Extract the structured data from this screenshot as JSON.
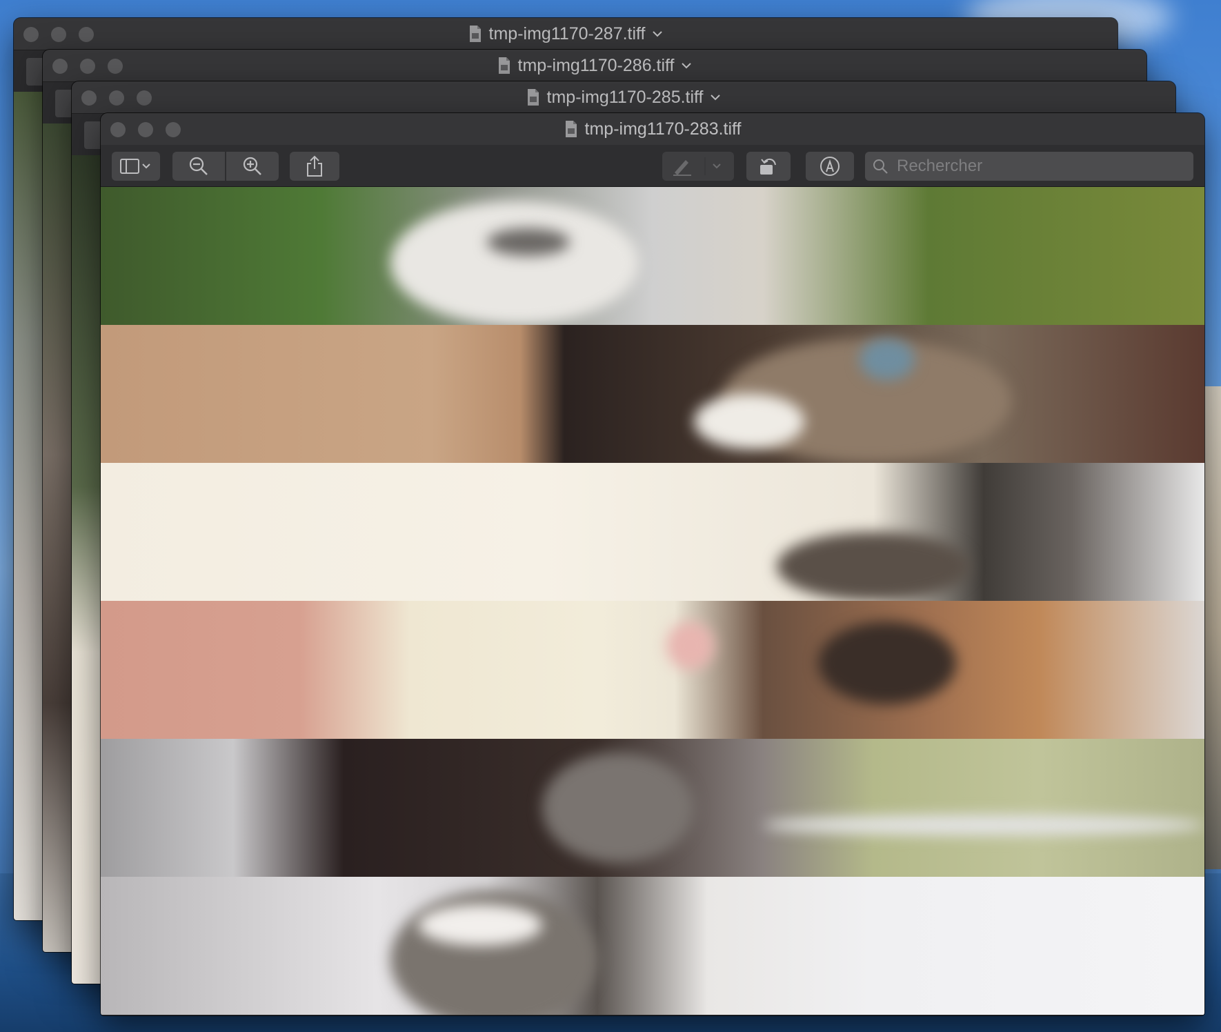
{
  "windows": [
    {
      "title": "tmp-img1170-287.tiff",
      "has_menu_chevron": true
    },
    {
      "title": "tmp-img1170-286.tiff",
      "has_menu_chevron": true
    },
    {
      "title": "tmp-img1170-285.tiff",
      "has_menu_chevron": true
    },
    {
      "title": "tmp-img1170-283.tiff",
      "has_menu_chevron": false
    }
  ],
  "toolbar": {
    "sidebar_icon": "sidebar-icon",
    "zoom_out_icon": "zoom-out-icon",
    "zoom_in_icon": "zoom-in-icon",
    "share_icon": "share-icon",
    "markup_icon": "pen-icon",
    "rotate_icon": "rotate-icon",
    "annotate_icon": "markup-circle-icon",
    "search_placeholder": "Rechercher"
  },
  "image_strips": [
    "kitten-paw-on-grass",
    "kitten-face-with-cardboard",
    "white-kitten-cuddling-tabby",
    "kitten-fed-with-bottle",
    "fluffy-kitten-on-windowsill",
    "striped-kitten-looking-down"
  ],
  "colors": {
    "window_bg": "#2b2b2d",
    "titlebar": "#363638",
    "toolbar_button": "#464648",
    "title_text": "#bfbfc1"
  }
}
